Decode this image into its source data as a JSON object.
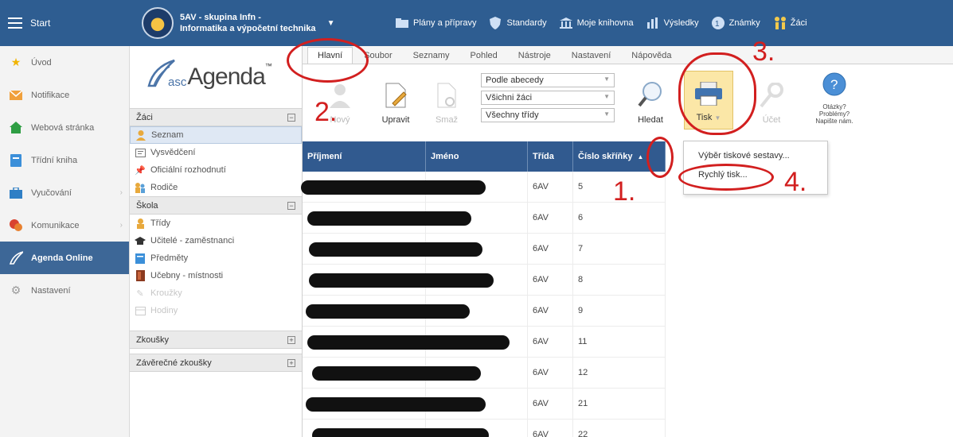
{
  "topbar": {
    "start_label": "Start",
    "school_line1": "5AV - skupina Infn -",
    "school_line2": "Informatika a výpočetní technika",
    "nav": [
      {
        "label": "Plány a přípravy",
        "icon": "folder-icon"
      },
      {
        "label": "Standardy",
        "icon": "shield-icon"
      },
      {
        "label": "Moje knihovna",
        "icon": "library-icon"
      },
      {
        "label": "Výsledky",
        "icon": "bar-chart-icon"
      },
      {
        "label": "Známky",
        "icon": "grades-icon"
      },
      {
        "label": "Žáci",
        "icon": "students-icon"
      }
    ]
  },
  "sidebar": {
    "items": [
      {
        "label": "Úvod",
        "icon": "star-icon",
        "color": "#f1b400"
      },
      {
        "label": "Notifikace",
        "icon": "mail-icon",
        "color": "#f0a03c"
      },
      {
        "label": "Webová stránka",
        "icon": "home-icon",
        "color": "#2f9e44"
      },
      {
        "label": "Třídní kniha",
        "icon": "book-icon",
        "color": "#3b8fd9"
      },
      {
        "label": "Vyučování",
        "icon": "briefcase-icon",
        "color": "#2f7fc5"
      },
      {
        "label": "Komunikace",
        "icon": "chat-icon",
        "color": "#d9432f"
      },
      {
        "label": "Agenda Online",
        "icon": "pen-icon",
        "color": "#ffffff"
      },
      {
        "label": "Nastavení",
        "icon": "gear-icon",
        "color": "#999999"
      }
    ]
  },
  "agenda": {
    "logo_prefix": "asc",
    "logo_word": "Agenda",
    "logo_tm": "™",
    "sections": {
      "zaci": "Žáci",
      "skola": "Škola",
      "zkousky": "Zkoušky",
      "zaverecne": "Závěrečné zkoušky"
    },
    "zaci_items": [
      "Seznam",
      "Vysvědčení",
      "Oficiální rozhodnutí",
      "Rodiče"
    ],
    "skola_items": [
      "Třídy",
      "Učitelé - zaměstnanci",
      "Předměty",
      "Učebny - místnosti",
      "Kroužky",
      "Hodiny"
    ]
  },
  "ribbon": {
    "tabs": [
      "Hlavní",
      "Soubor",
      "Seznamy",
      "Pohled",
      "Nástroje",
      "Nastavení",
      "Nápověda"
    ],
    "buttons": {
      "novy": "Nový",
      "upravit": "Upravit",
      "smaz": "Smaž",
      "hledat": "Hledat",
      "tisk": "Tisk",
      "ucet": "Účet",
      "help1": "Otázky?",
      "help2": "Problémy?",
      "help3": "Napište nám."
    },
    "selects": [
      "Podle abecedy",
      "Všichni žáci",
      "Všechny třídy"
    ]
  },
  "table": {
    "headers": [
      "Příjmení",
      "Jméno",
      "Třída",
      "Číslo skříňky"
    ],
    "rows": [
      {
        "trida": "6AV",
        "cislo": "5"
      },
      {
        "trida": "6AV",
        "cislo": "6"
      },
      {
        "trida": "6AV",
        "cislo": "7"
      },
      {
        "trida": "6AV",
        "cislo": "8"
      },
      {
        "trida": "6AV",
        "cislo": "9"
      },
      {
        "trida": "6AV",
        "cislo": "11"
      },
      {
        "trida": "6AV",
        "cislo": "12"
      },
      {
        "trida": "6AV",
        "cislo": "21"
      },
      {
        "trida": "6AV",
        "cislo": "22"
      }
    ],
    "sort_indicator": "▲"
  },
  "dropdown": {
    "items": [
      "Výběr tiskové sestavy...",
      "Rychlý tisk..."
    ]
  },
  "annotations": {
    "n1": "1.",
    "n2": "2.",
    "n3": "3.",
    "n4": "4.",
    "color": "#d21f1f"
  }
}
